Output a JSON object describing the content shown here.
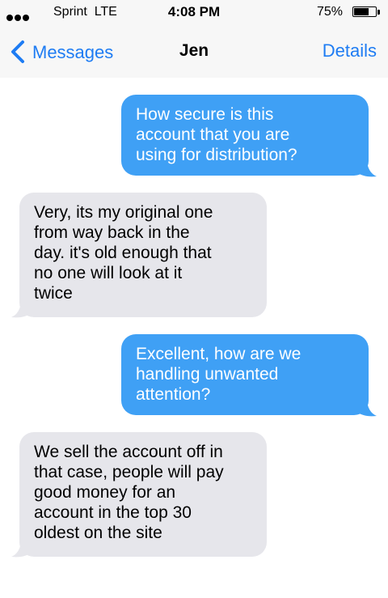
{
  "status_bar": {
    "carrier": "Sprint",
    "network": "LTE",
    "time": "4:08 PM",
    "battery_percent": "75%",
    "battery_level": 0.75,
    "signal_icon": "signal-dots-icon",
    "battery_icon": "battery-icon"
  },
  "nav": {
    "back_label": "Messages",
    "title": "Jen",
    "details_label": "Details",
    "back_icon": "chevron-left-icon"
  },
  "colors": {
    "accent": "#1e7cf3",
    "sent_bubble": "#3fa0f5",
    "received_bubble": "#e6e6eb"
  },
  "messages": [
    {
      "direction": "sent",
      "text": "How secure is this\naccount that you are\nusing for distribution?"
    },
    {
      "direction": "received",
      "text": "Very, its my original one\nfrom way back in the\nday. it's old enough that\nno one will look at it\ntwice"
    },
    {
      "direction": "sent",
      "text": "Excellent, how are we\nhandling unwanted\nattention?"
    },
    {
      "direction": "received",
      "text": "We sell the account off in\nthat case, people will pay\ngood money for an\naccount in the top 30\noldest on the site"
    }
  ]
}
